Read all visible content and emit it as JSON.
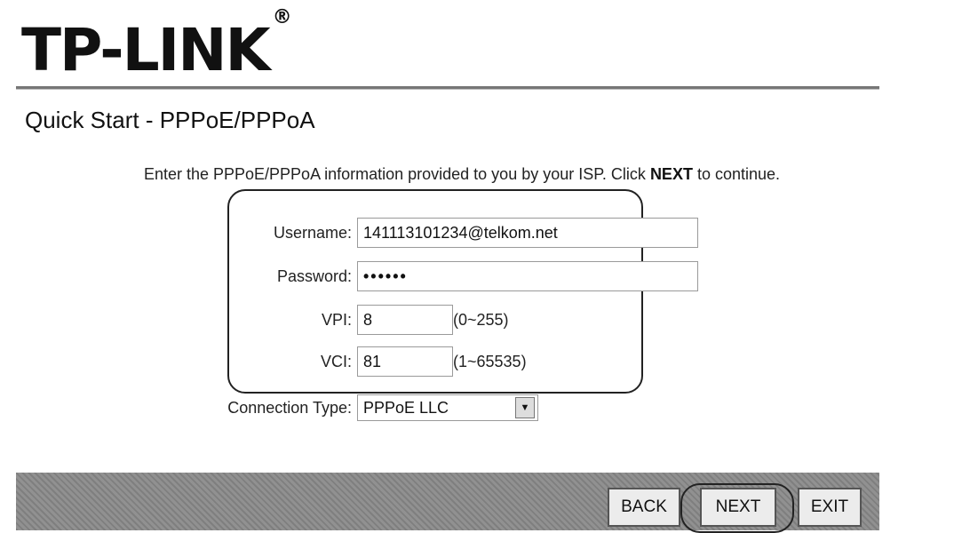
{
  "logo": {
    "text": "TP-LINK",
    "mark": "®"
  },
  "page_title": "Quick Start - PPPoE/PPPoA",
  "instructions": {
    "before": "Enter the PPPoE/PPPoA information provided to you by your ISP. Click ",
    "bold": "NEXT",
    "after": " to continue."
  },
  "form": {
    "username": {
      "label": "Username:",
      "value": "141113101234@telkom.net"
    },
    "password": {
      "label": "Password:",
      "value": "••••••"
    },
    "vpi": {
      "label": "VPI:",
      "value": "8",
      "range": "(0~255)"
    },
    "vci": {
      "label": "VCI:",
      "value": "81",
      "range": "(1~65535)"
    },
    "connection_type": {
      "label": "Connection Type:",
      "value": "PPPoE LLC"
    }
  },
  "buttons": {
    "back": "BACK",
    "next": "NEXT",
    "exit": "EXIT"
  }
}
